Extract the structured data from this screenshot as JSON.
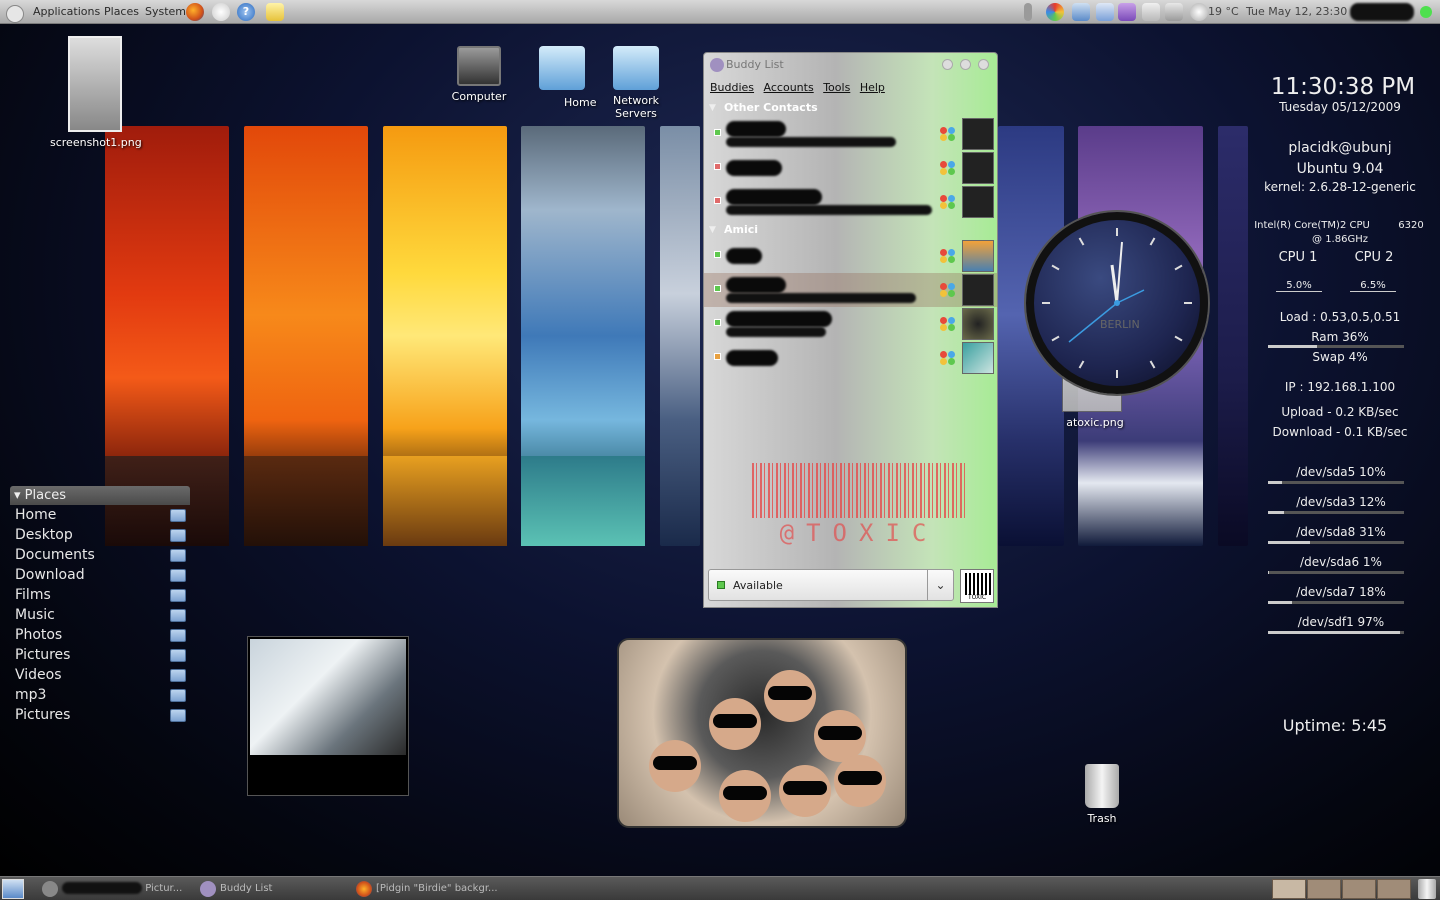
{
  "top_panel": {
    "menus": [
      "Applications",
      "Places",
      "System"
    ],
    "weather": "19 °C",
    "datetime": "Tue May 12, 23:30"
  },
  "desktop_icons": {
    "screenshot": "screenshot1.png",
    "computer": "Computer",
    "home": "Home",
    "network_servers": "Network Servers",
    "atoxic": "atoxic.png",
    "trash": "Trash"
  },
  "places": {
    "title": "Places",
    "items": [
      "Home",
      "Desktop",
      "Documents",
      "Download",
      "Films",
      "Music",
      "Photos",
      "Pictures",
      "Videos",
      "mp3",
      "Pictures"
    ]
  },
  "buddy_list": {
    "title": "Buddy List",
    "menus": [
      "Buddies",
      "Accounts",
      "Tools",
      "Help"
    ],
    "groups": [
      "Other Contacts",
      "Amici"
    ],
    "status": "Available",
    "barcode_text": "@TOXIC",
    "logo_text": "TOXIC"
  },
  "conky": {
    "time": "11:30:38 PM",
    "date": "Tuesday 05/12/2009",
    "user": "placidk@ubunj",
    "os": "Ubuntu 9.04",
    "kernel": "kernel: 2.6.28-12-generic",
    "cpu_model_1": "Intel(R) Core(TM)2 CPU",
    "cpu_model_num": "6320",
    "cpu_model_2": "@ 1.86GHz",
    "cpu1_label": "CPU 1",
    "cpu2_label": "CPU 2",
    "cpu1_value": "5.0%",
    "cpu2_value": "6.5%",
    "load": "Load : 0.53,0.5,0.51",
    "ram": "Ram 36%",
    "swap": "Swap 4%",
    "ip": "IP : 192.168.1.100",
    "upload": "Upload - 0.2 KB/sec",
    "download": "Download - 0.1 KB/sec",
    "disks": [
      "/dev/sda5 10%",
      "/dev/sda3 12%",
      "/dev/sda8 31%",
      "/dev/sda6 1%",
      "/dev/sda7 18%",
      "/dev/sdf1 97%"
    ],
    "disk_levels": [
      0.1,
      0.12,
      0.31,
      0.01,
      0.18,
      0.97
    ],
    "ram_level": 0.36,
    "swap_level": 0.04,
    "uptime": "Uptime: 5:45"
  },
  "clock_label": "BERLIN",
  "taskbar": {
    "tasks": [
      "Pictur...",
      "Buddy List",
      "[Pidgin \"Birdie\" backgr..."
    ]
  },
  "colors": {
    "available": "#5ec84e",
    "away": "#e06a6a",
    "idle": "#e8a040"
  }
}
